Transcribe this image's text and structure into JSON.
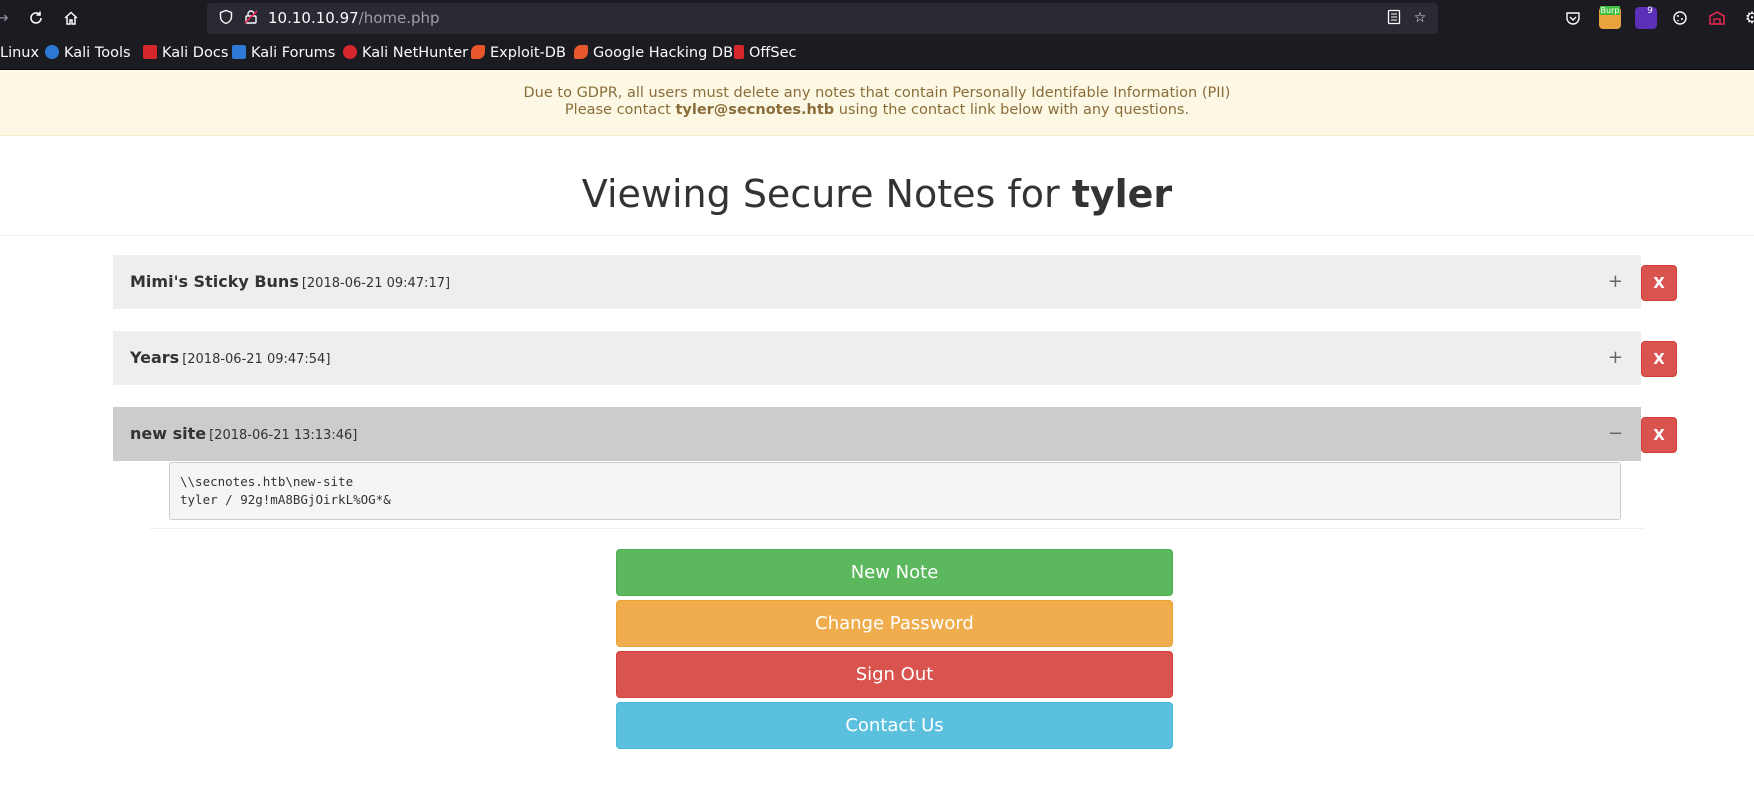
{
  "browser": {
    "url_host": "10.10.10.97",
    "url_path": "/home.php",
    "extensions": [
      {
        "name": "burp-extension",
        "label": "Burp"
      },
      {
        "name": "badge-extension",
        "label": "9"
      }
    ],
    "bookmarks": [
      {
        "label": "Linux",
        "color": "#1c1b22"
      },
      {
        "label": "Kali Tools",
        "color": "#2d7ad6"
      },
      {
        "label": "Kali Docs",
        "color": "#d5262b"
      },
      {
        "label": "Kali Forums",
        "color": "#2d7ad6"
      },
      {
        "label": "Kali NetHunter",
        "color": "#d5262b"
      },
      {
        "label": "Exploit-DB",
        "color": "#e8572c"
      },
      {
        "label": "Google Hacking DB",
        "color": "#e8572c"
      },
      {
        "label": "OffSec",
        "color": "#d5262b"
      }
    ]
  },
  "alert": {
    "line1": "Due to GDPR, all users must delete any notes that contain Personally Identifable Information (PII)",
    "line2_prefix": "Please contact ",
    "email": "tyler@secnotes.htb",
    "line2_suffix": " using the contact link below with any questions."
  },
  "heading": {
    "prefix": "Viewing Secure Notes for ",
    "username": "tyler"
  },
  "notes": [
    {
      "title": "Mimi's Sticky Buns",
      "date": "[2018-06-21 09:47:17]",
      "toggle": "+",
      "delete_label": "X"
    },
    {
      "title": "Years",
      "date": "[2018-06-21 09:47:54]",
      "toggle": "+",
      "delete_label": "X"
    },
    {
      "title": "new site",
      "date": "[2018-06-21 13:13:46]",
      "toggle": "−",
      "delete_label": "X",
      "content_line1": "\\\\secnotes.htb\\new-site",
      "content_line2": "tyler / 92g!mA8BGjOirkL%OG*&"
    }
  ],
  "actions": {
    "new_note": "New Note",
    "change_password": "Change Password",
    "sign_out": "Sign Out",
    "contact_us": "Contact Us"
  },
  "colors": {
    "alert_bg": "#fcf8e3",
    "alert_text": "#8a6d3b",
    "success": "#5cb85c",
    "warning": "#f0ad4e",
    "danger": "#d9534f",
    "info": "#5bc0de"
  }
}
